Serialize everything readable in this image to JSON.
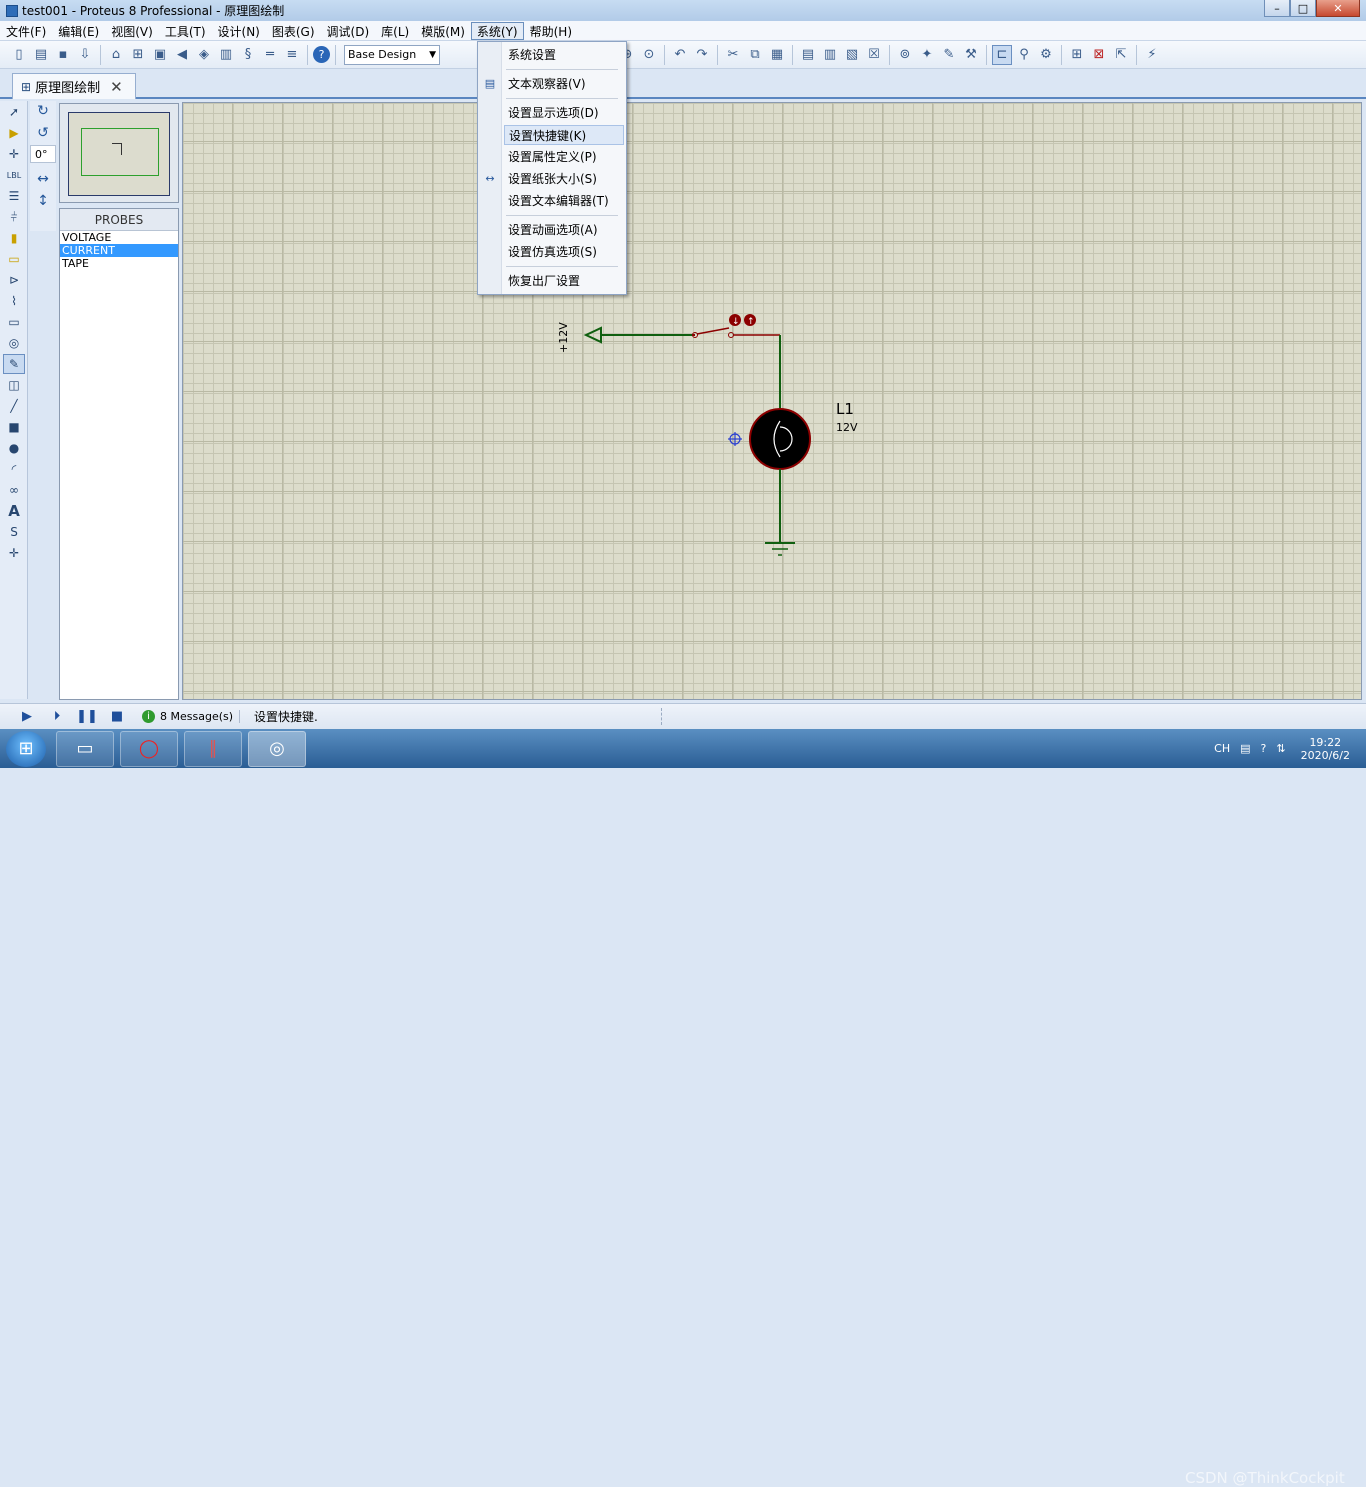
{
  "window": {
    "title": "test001 - Proteus 8 Professional - 原理图绘制",
    "min": "–",
    "max": "□",
    "close": "✕"
  },
  "menu": [
    "文件(F)",
    "编辑(E)",
    "视图(V)",
    "工具(T)",
    "设计(N)",
    "图表(G)",
    "调试(D)",
    "库(L)",
    "模版(M)",
    "系统(Y)",
    "帮助(H)"
  ],
  "toolbar": {
    "design_select": "Base Design"
  },
  "tab": {
    "label": "原理图绘制",
    "close": "✕"
  },
  "rotate": {
    "angle": "0°"
  },
  "probes": {
    "header": "PROBES",
    "items": [
      "VOLTAGE",
      "CURRENT",
      "TAPE"
    ],
    "selected": "CURRENT"
  },
  "dropdown": {
    "items": [
      "系统设置",
      "文本观察器(V)",
      "设置显示选项(D)",
      "设置快捷键(K)",
      "设置属性定义(P)",
      "设置纸张大小(S)",
      "设置文本编辑器(T)",
      "设置动画选项(A)",
      "设置仿真选项(S)",
      "恢复出厂设置"
    ],
    "highlighted": "设置快捷键(K)"
  },
  "schematic": {
    "power_label": "+12V",
    "lamp_ref": "L1",
    "lamp_value": "12V"
  },
  "status": {
    "messages": "8 Message(s)",
    "text": "设置快捷键."
  },
  "taskbar": {
    "tray": {
      "lang": "CH",
      "time": "19:22",
      "date": "2020/6/2"
    },
    "watermark": "CSDN @ThinkCockpit"
  },
  "colors": {
    "grid": "#dcdccb",
    "wire": "#0f5f0f",
    "component": "#8b0000",
    "highlight": "#3399ff"
  }
}
